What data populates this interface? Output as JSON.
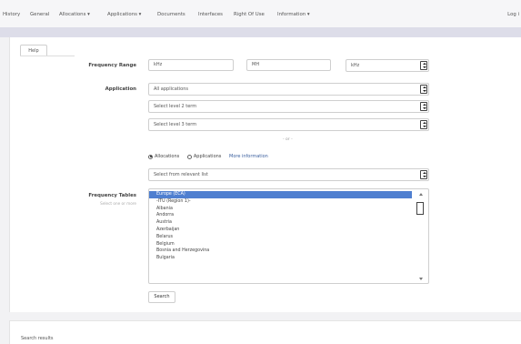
{
  "nav": {
    "items": [
      "History",
      "General",
      "Allocations ▾",
      "Applications ▾",
      "Documents",
      "Interfaces",
      "Right Of Use",
      "Information ▾"
    ],
    "login": "Log i"
  },
  "help_tab": "Help",
  "form": {
    "frequency_range": {
      "label": "Frequency Range",
      "from": "kHz",
      "to": "MH",
      "unit": "kHz"
    },
    "application": {
      "label": "Application",
      "select1": "All applications",
      "select2": "Select level 2 term",
      "select3": "Select level 3 term"
    },
    "or_text": "- or -",
    "radios": {
      "option1": "Allocations",
      "option2": "Applications",
      "option1_checked": true,
      "option2_checked": false,
      "info_link": "More information"
    },
    "dropdown": "Select from relevant list",
    "frequency_tables": {
      "label": "Frequency Tables",
      "hint": "Select one or more",
      "items": [
        "Europe (ECA)",
        "-ITU (Region 1)-",
        "Albania",
        "Andorra",
        "Austria",
        "Azerbaijan",
        "Belarus",
        "Belgium",
        "Bosnia and Herzegovina",
        "Bulgaria"
      ],
      "selected_index": 0
    },
    "search_button": "Search"
  },
  "results": {
    "label": "Search results"
  }
}
